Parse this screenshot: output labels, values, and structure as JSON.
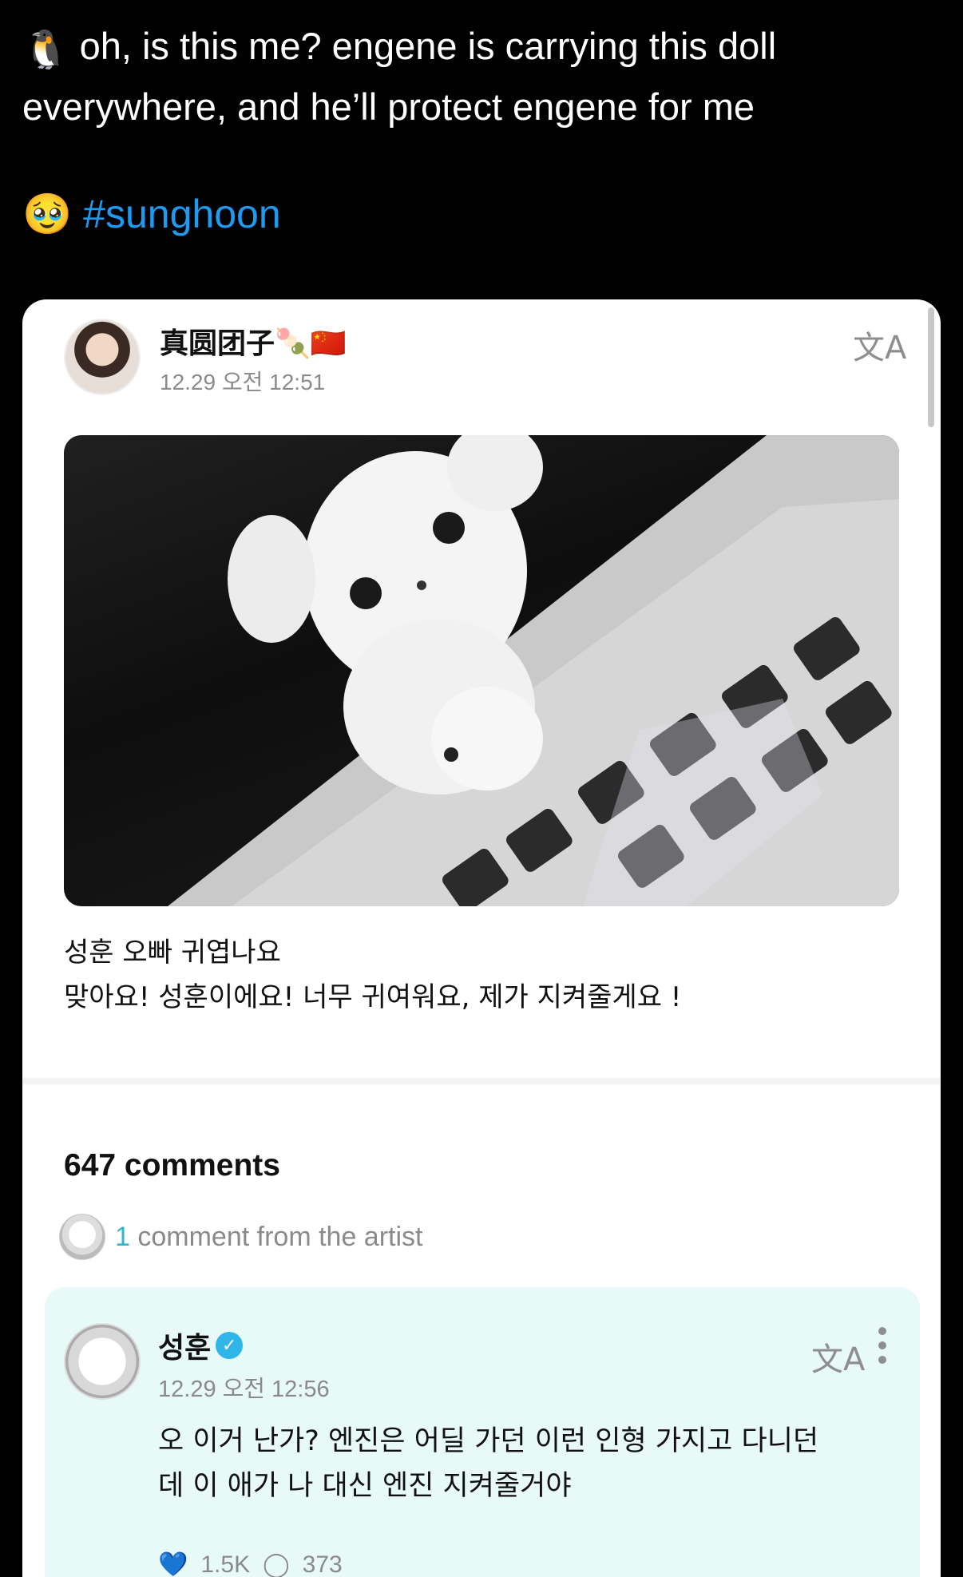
{
  "tweet": {
    "line1": "oh, is this me? engene is carrying this doll",
    "line2": "everywhere, and he’ll protect engene for me",
    "hashtag": "#sunghoon",
    "emoji_lead": "🐧",
    "emoji_face": "🥹"
  },
  "post": {
    "username": "真圆团子",
    "username_emojis": "🍡🇨🇳",
    "timestamp": "12.29 오전 12:51",
    "caption_line1": "성훈 오빠 귀엽나요",
    "caption_line2": "맞아요! 성훈이에요! 너무 귀여워요, 제가 지켜줄게요 !"
  },
  "comments": {
    "count_label": "647 comments",
    "artist_count": "1",
    "artist_note": "comment from the artist"
  },
  "artist_comment": {
    "username": "성훈",
    "timestamp": "12.29 오전 12:56",
    "body_line1": "오 이거 난가? 엔진은 어딜 가던 이런 인형 가지고 다니던",
    "body_line2": "데 이 애가 나 대신 엔진 지켜줄거야",
    "likes": "1.5K",
    "replies": "373"
  },
  "icons": {
    "translate": "translate-icon",
    "more": "more-vertical-icon",
    "verified": "verified-badge-icon",
    "like": "like-icon",
    "reply": "comment-bubble-icon"
  },
  "colors": {
    "hashtag": "#1d9bf0",
    "accent": "#2fb7c9",
    "comment_bg": "#e8faf8"
  }
}
